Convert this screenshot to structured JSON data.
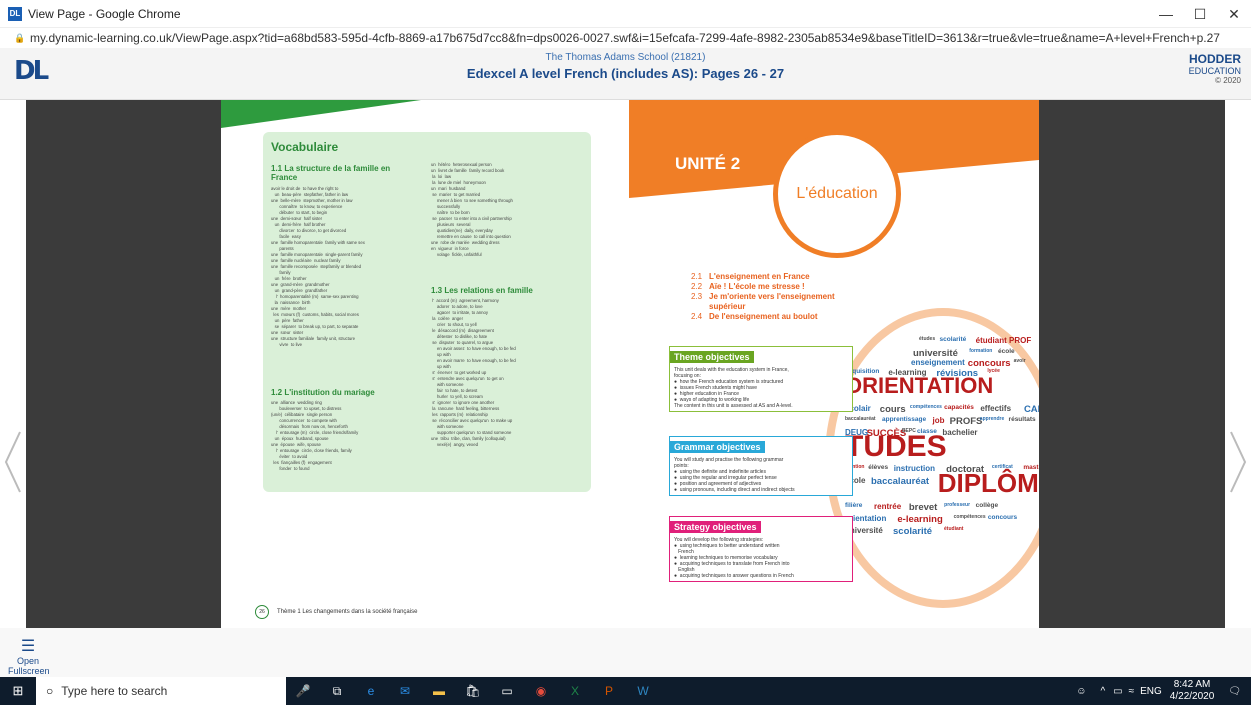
{
  "window": {
    "title": "View Page - Google Chrome",
    "min": "—",
    "max": "☐",
    "close": "✕"
  },
  "address": {
    "url": "my.dynamic-learning.co.uk/ViewPage.aspx?tid=a68bd583-595d-4cfb-8869-a17b675d7cc8&fn=dps0026-0027.swf&i=15efcafa-7299-4afe-8982-2305ab8534e9&baseTitleID=3613&r=true&vle=true&name=A+level+French+p.27"
  },
  "app": {
    "logo": "DL",
    "school": "The Thomas Adams School (21821)",
    "book_title": "Edexcel A level French (includes AS): Pages 26 - 27",
    "publisher": "HODDER",
    "publisher_sub": "EDUCATION",
    "copyright": "© 2020"
  },
  "left_page": {
    "heading": "Vocabulaire",
    "s11": "1.1 La structure de la famille en France",
    "s12": "1.2 L'institution du mariage",
    "s13": "1.3 Les relations en famille",
    "col1": "avoir le droit de  to have the right to\n   un  beau-père  stepfather, father in law\nune  belle-mère  stepmother, mother in law\n       connaître  to know, to experience\n       débuter  to start, to begin\nune  demi-sœur  half sister\n   un  demi-frère  half brother\n       divorcer  to divorce, to get divorced\n       facile  easy\nune  famille homoparentale  family with same sex\n       parents\nune  famille monoparentale  single-parent family\nune  famille nucléaire  nuclear family\nune  famille recomposée  stepfamily or blended\n       family\n   un  frère  brother\nune  grand-mère  grandmother\n   un  grand-père  grandfather\n    l'  homoparentalité (m)  same-sex parenting\n   la  naissance  birth\nune  mère  mother\n  les  mœurs (f)  customs, habits, social mores\n   un  père  father\n   se  séparer  to break up, to part, to separate\nune  sœur  sister\nune  structure familiale  family unit, structure\n       vivre  to live",
    "col1b": "une  alliance  wedding ring\n       bouleverser  to upset, to distress\n(un/e)  célibataire  single person\n       concurrencer  to compete with\n       désormais  from now on, henceforth\n    l'  entourage (m)  circle, close friends/family\n   un  époux  husband, spouse\nune  épouse  wife, spouse\n    l'  entourage  circle, close friends, family\n       éviter  to avoid\n  les  fiançailles (f)  engagement\n       fonder  to found",
    "col2": "un  hétéro  heterosexual person\nun  livret de famille  family record book\n la  loi  law\n la  lune de miel  honeymoon\nun  mari  husband\n se  marier  to get married\n     mener à bien  to see something through\n     successfully\n     naître  to be born\n se  pacser  to enter into a civil partnership\n     plusieurs  several\n     quotidien(ne)  daily, everyday\n     remettre en cause  to call into question\nune  robe de mariée  wedding dress\nen  vigueur  in force\n     volage  fickle, unfaithful",
    "col2b": " l'  accord (m)  agreement, harmony\n     adorer  to adore, to love\n     agacer  to irritate, to annoy\n la  colère  anger\n     crier  to shout, to yell\n le  désaccord (m)  disagreement\n     détester  to dislike, to hate\n se  disputer  to quarrel, to argue\n     en avoir assez  to have enough, to be fed\n     up with\n     en avoir marre  to have enough, to be fed\n     up with\n s'  énerver  to get worked up\n s'  entendre avec quelqu'un  to get on\n     with someone\n     fair  to hate, to detest\n     hurler  to yell, to scream\n s'  ignorer  to ignore one another\n la  rancune  hard feeling, bitterness\n les  rapports (m)  relationship\n se  réconcilier avec quelqu'un  to make up\n     with someone\n     supporter quelqu'un  to stand someone\nune  tribu  tribe, clan, family (colloquial)\n     vexé(e)  angry, vexed",
    "page_num": "26",
    "footer": "Thème 1  Les changements dans la société française"
  },
  "right_page": {
    "unit": "UNITÉ 2",
    "title": "L'éducation",
    "topics": [
      {
        "n": "2.1",
        "t": "L'enseignement en France"
      },
      {
        "n": "2.2",
        "t": "Aïe ! L'école me stresse !"
      },
      {
        "n": "2.3",
        "t": "Je m'oriente vers l'enseignement"
      },
      {
        "n": "",
        "t": "supérieur"
      },
      {
        "n": "2.4",
        "t": "De l'enseignement au boulot"
      }
    ],
    "theme_hd": "Theme objectives",
    "theme_bd": "This unit deals with the education system in France,\nfocusing on:\n●  how the French education system is structured\n●  issues French students might have\n●  higher education in France\n●  ways of adapting to working life\nThe content in this unit is assessed at AS and A-level.",
    "grammar_hd": "Grammar objectives",
    "grammar_bd": "You will study and practise the following grammar\npoints:\n●  using the definite and indefinite articles\n●  using the regular and irregular perfect tense\n●  position and agreement of adjectives\n●  using pronouns, including direct and indirect objects",
    "strategy_hd": "Strategy objectives",
    "strategy_bd": "You will develop the following strategies:\n●  using techniques to better understand written\n   French\n●  learning techniques to memorise vocabulary\n●  acquiring techniques to translate from French into\n   English\n●  acquiring techniques to answer questions in French",
    "words": [
      "études",
      "scolarité",
      "étudiant PROF",
      "université",
      "formation",
      "école",
      "enseignement",
      "concours",
      "avoir",
      "acquisition",
      "e-learning",
      "révisions",
      "lycée",
      "ORIENTATION",
      "scolair",
      "cours",
      "compétences",
      "capacités",
      "effectifs",
      "CAP",
      "baccalauréat",
      "apprentissage",
      "job",
      "PROFS",
      "apprendre",
      "résultats",
      "DEUG",
      "SUCCÈS",
      "BEPC",
      "classe",
      "bachelier",
      "TUDES",
      "mention",
      "élèves",
      "instruction",
      "doctorat",
      "certificat",
      "master",
      "école",
      "baccalauréat",
      "DIPLÔME",
      "filière",
      "rentrée",
      "brevet",
      "professeur",
      "collège",
      "orientation",
      "e-learning",
      "compétences",
      "concours",
      "université",
      "scolarité",
      "étudiant"
    ]
  },
  "bottom": {
    "fs_icon": "☰",
    "fs_label": "Open Fullscreen"
  },
  "taskbar": {
    "search": "Type here to search",
    "time": "8:42 AM",
    "date": "4/22/2020",
    "lang": "ENG"
  }
}
